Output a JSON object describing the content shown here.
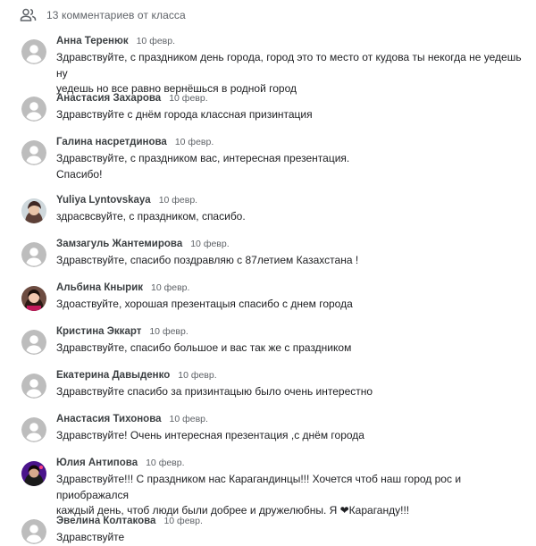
{
  "header": {
    "icon": "people-icon",
    "text": "13 комментариев от класса"
  },
  "comments": [
    {
      "name": "Анна Теренюк",
      "date": "10 февр.",
      "avatar": "default-avatar-icon",
      "text": "Здравствуйте, с праздником день города, город это то место от кудова ты некогда не уедешь ну\nуедешь но все равно вернёшься в родной город"
    },
    {
      "name": "Анастасия Захарова",
      "date": "10 февр.",
      "avatar": "default-avatar-icon",
      "text": "Здравствуйте с днём города классная призинтация"
    },
    {
      "name": "Галина насретдинова",
      "date": "10 февр.",
      "avatar": "default-avatar-icon",
      "text": "Здравствуйте, с праздником вас, интересная презентация.\nСпасибо!"
    },
    {
      "name": "Yuliya Lyntovskaya",
      "date": "10 февр.",
      "avatar": "profile-photo",
      "text": "здрасвсвуйте, с праздником, спасибо."
    },
    {
      "name": "Замзагуль Жантемирова",
      "date": "10 февр.",
      "avatar": "default-avatar-icon",
      "text": "Здравствуйте, спасибо поздравляю с 87летием Казахстана !"
    },
    {
      "name": "Альбина Кнырик",
      "date": "10 февр.",
      "avatar": "profile-photo",
      "text": "Здоаствуйте, хорошая презентацыя спасибо с днем города"
    },
    {
      "name": "Кристина Эккарт",
      "date": "10 февр.",
      "avatar": "default-avatar-icon",
      "text": "Здравствуйте, спасибо большое и вас так же с праздником"
    },
    {
      "name": "Екатерина Давыденко",
      "date": "10 февр.",
      "avatar": "default-avatar-icon",
      "text": "Здравствуйте спасибо за призинтацыю было очень интерестно"
    },
    {
      "name": "Анастасия Тихонова",
      "date": "10 февр.",
      "avatar": "default-avatar-icon",
      "text": "Здравствуйте! Очень интересная презентация ,с днём города"
    },
    {
      "name": "Юлия Антипова",
      "date": "10 февр.",
      "avatar": "profile-photo",
      "text": "Здравствуйте!!! С праздником нас Карагандинцы!!! Хочется чтоб наш город рос и приображался\nкаждый день, чтоб люди были добрее и дружелюбны. Я ❤Караганду!!!"
    },
    {
      "name": "Эвелина Колтакова",
      "date": "10 февр.",
      "avatar": "default-avatar-icon",
      "text": "Здравствуйте"
    }
  ]
}
